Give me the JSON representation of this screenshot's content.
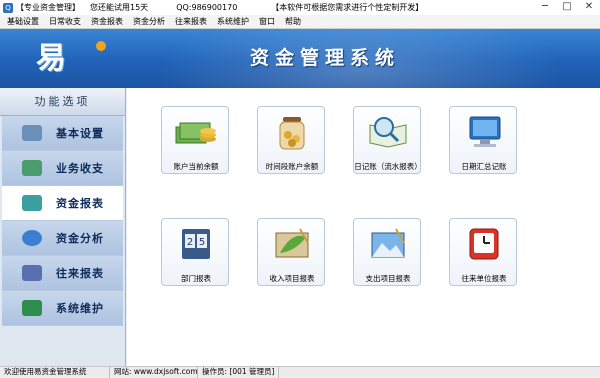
{
  "titlebar": {
    "app_name": "【专业资金管理】",
    "trial": "您还能试用15天",
    "qq": "QQ:986900170",
    "custom": "【本软件可根据您需求进行个性定制开发】",
    "min": "─",
    "max": "□",
    "close": "✕"
  },
  "menu": [
    "基础设置",
    "日常收支",
    "资金报表",
    "资金分析",
    "往来报表",
    "系统维护",
    "窗口",
    "帮助"
  ],
  "banner": {
    "logo": "易",
    "title": "资金管理系统"
  },
  "nav": {
    "header": "功能选项",
    "items": [
      {
        "label": "基本设置",
        "icon": "gear-icon",
        "color": "#6a8fb8"
      },
      {
        "label": "业务收支",
        "icon": "stack-icon",
        "color": "#4a9d6a"
      },
      {
        "label": "资金报表",
        "icon": "book-icon",
        "color": "#3aa0a0"
      },
      {
        "label": "资金分析",
        "icon": "globe-icon",
        "color": "#3a7fd0"
      },
      {
        "label": "往来报表",
        "icon": "people-icon",
        "color": "#5a6fb0"
      },
      {
        "label": "系统维护",
        "icon": "network-icon",
        "color": "#2f8e4e"
      }
    ],
    "active_index": 2
  },
  "tiles": [
    {
      "label": "账户当前余额",
      "icon": "money-icon"
    },
    {
      "label": "时间段账户余额",
      "icon": "coin-jar-icon"
    },
    {
      "label": "日记账（流水报表）",
      "icon": "magnifier-book-icon"
    },
    {
      "label": "日期汇总记账",
      "icon": "computer-icon"
    },
    {
      "label": "部门报表",
      "icon": "calendar-icon"
    },
    {
      "label": "收入项目报表",
      "icon": "leaf-board-icon"
    },
    {
      "label": "支出项目报表",
      "icon": "landscape-icon"
    },
    {
      "label": "往来单位报表",
      "icon": "clock-icon"
    }
  ],
  "status": {
    "welcome": "欢迎使用易资金管理系统",
    "website": "网站: www.dxjsoft.com",
    "operator": "操作员: [001 管理员]"
  }
}
